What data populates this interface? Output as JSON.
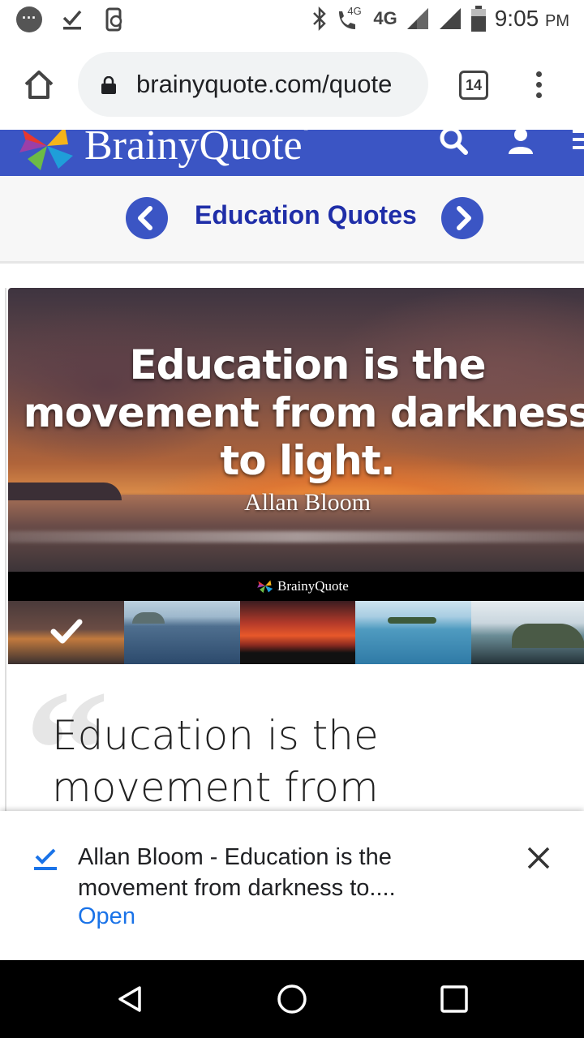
{
  "status_bar": {
    "time": "9:05",
    "ampm": "PM",
    "network_small": "4G",
    "network": "4G"
  },
  "browser": {
    "url": "brainyquote.com/quote",
    "tab_count": "14"
  },
  "site": {
    "logo_text": "BrainyQuote",
    "logo_mark_symbol": "®"
  },
  "topic_nav": {
    "title": "Education Quotes"
  },
  "quote_card": {
    "image_quote": "Education is the movement from darkness to light.",
    "image_author": "Allan Bloom",
    "brand_strip": "BrainyQuote",
    "quote_mark": "“",
    "quote_text": "Education is the movement from"
  },
  "download": {
    "title": "Allan Bloom - Education is the movement from darkness to....",
    "action": "Open"
  },
  "colors": {
    "brand_blue": "#3b55c4",
    "topic_title": "#1f2ea8",
    "link_blue": "#1a73e8"
  },
  "icons": [
    "chat-icon",
    "download-done-icon",
    "screen-rotate-icon",
    "bluetooth-icon",
    "wifi-calling-icon",
    "signal-icon",
    "battery-icon",
    "home-icon",
    "lock-icon",
    "tabs-icon",
    "more-icon",
    "search-icon",
    "user-icon",
    "hamburger-icon",
    "chevron-left-icon",
    "chevron-right-icon",
    "check-icon",
    "close-icon",
    "back-icon",
    "circle-home-icon",
    "square-recent-icon"
  ]
}
